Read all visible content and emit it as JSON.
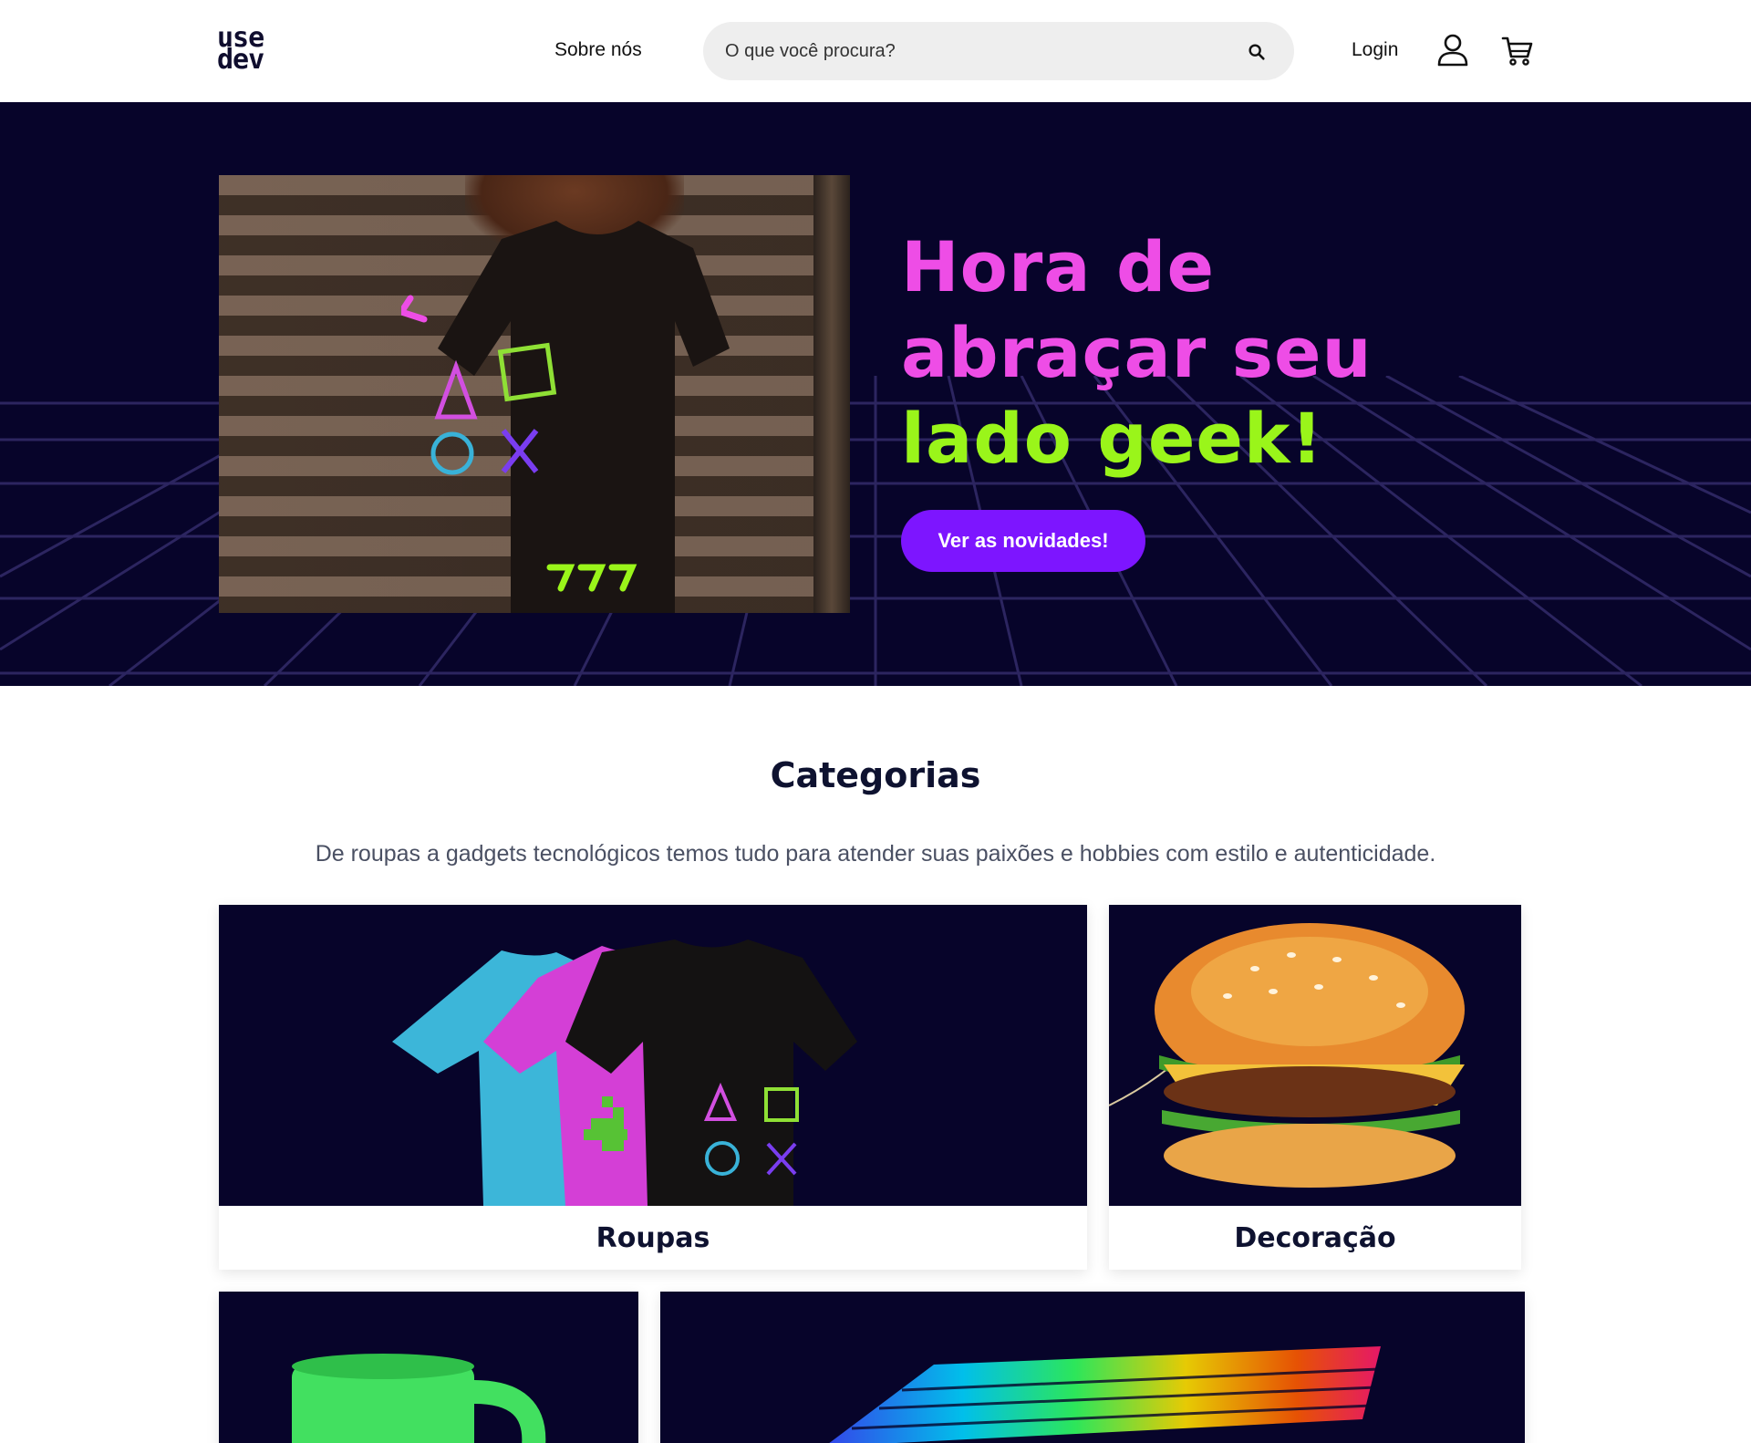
{
  "header": {
    "logo_top": "use",
    "logo_bottom": "dev",
    "about_label": "Sobre nós",
    "search_placeholder": "O que você procura?",
    "login_label": "Login"
  },
  "hero": {
    "title_line1": "Hora de",
    "title_line2": "abraçar seu",
    "title_line3": "lado geek!",
    "cta_label": "Ver as novidades!",
    "colors": {
      "background": "#07042a",
      "pink": "#ee4de6",
      "green": "#9af51a",
      "button": "#7d15ff"
    }
  },
  "categories": {
    "title": "Categorias",
    "subtitle": "De roupas a gadgets tecnológicos temos tudo para atender suas paixões e hobbies com estilo e autenticidade.",
    "items": [
      {
        "label": "Roupas"
      },
      {
        "label": "Decoração"
      },
      {
        "label": ""
      },
      {
        "label": ""
      }
    ]
  }
}
